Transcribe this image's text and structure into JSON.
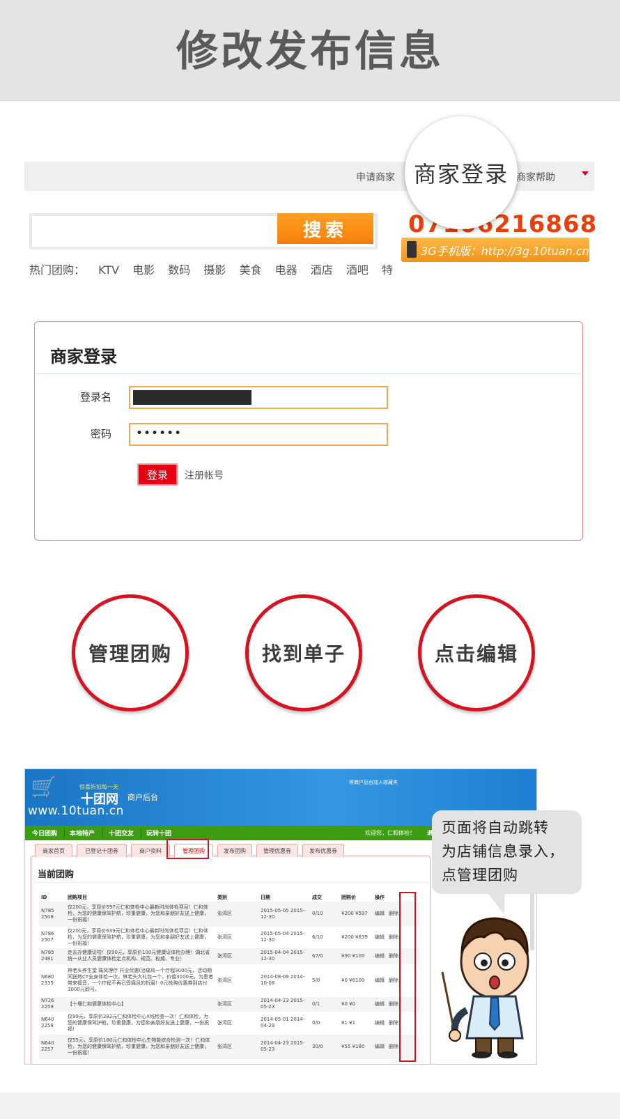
{
  "banner": {
    "title": "修改发布信息"
  },
  "topbar": {
    "apply_link": "申请商家",
    "merchant_login_zoom": "商家登录",
    "help_link": "商家帮助"
  },
  "search": {
    "button": "搜索",
    "hot_label": "热门团购：",
    "hot_items": [
      "KTV",
      "电影",
      "数码",
      "摄影",
      "美食",
      "电器",
      "酒店",
      "酒吧",
      "特"
    ]
  },
  "contact": {
    "phone": "07106216868",
    "mobile_banner": "3G手机版：http://3g.10tuan.cn"
  },
  "login": {
    "title": "商家登录",
    "username_label": "登录名",
    "password_label": "密码",
    "password_value": "••••••",
    "submit": "登录",
    "register": "注册帐号"
  },
  "steps": [
    "管理团购",
    "找到单子",
    "点击编辑"
  ],
  "admin": {
    "slogan": "惊喜折扣每一天",
    "brand": "十团网",
    "backend": "商户后台",
    "url": "www.10tuan.cn",
    "favorite": "将商户后台加入收藏夹",
    "nav": [
      "今日团购",
      "本地特产",
      "十团交友",
      "玩转十团"
    ],
    "welcome": "欢迎您，仁和体检！",
    "logout": "退出",
    "tabs": [
      "商家首页",
      "已登记十团券",
      "商户资料",
      "管理团购",
      "发布团购",
      "管理优惠券",
      "发布优惠券"
    ],
    "section_title": "当前团购",
    "columns": [
      "ID",
      "团购项目",
      "类别",
      "日期",
      "成交",
      "团购价",
      "操作"
    ],
    "rows": [
      {
        "id": "N785 2508",
        "item": "仅200元，享原价597元仁和体检中心最新时尚体检项目！仁和体检，为您的健康保驾护航，珍重健康，为您和亲朋好友送上健康，一份祝福！",
        "cat": "张湾区",
        "date": "2015-05-05 2015-12-30",
        "deal": "0/10",
        "price": "¥200 ¥597",
        "edit": "编辑",
        "del": "删除"
      },
      {
        "id": "N786 2507",
        "item": "仅200元，享原价639元仁和体检中心最新时尚体检项目！仁和体检，为您的健康保驾护航，珍重健康，为您和亲朋好友送上健康，一份祝福！",
        "cat": "张湾区",
        "date": "2015-05-04 2015-12-30",
        "deal": "6/10",
        "price": "¥200 ¥639",
        "edit": "编辑",
        "del": "删除"
      },
      {
        "id": "N785 2481",
        "item": "走去办健康证啦！仅90元，享原价100元健康证体检办理！湖北省统一从业人员健康体检定点机构、规范、权威、专业！",
        "cat": "张湾区",
        "date": "2015-04-04 2015-12-30",
        "deal": "67/0",
        "price": "¥90 ¥100",
        "edit": "编辑",
        "del": "删除"
      },
      {
        "id": "N680 2335",
        "item": "林老头养生堂 痛风理疗 开业优惠(治痛风一个疗程3000元，活动期间送热CT全身体检一次，林老头大礼包一个，价值3100元，为患者带来福音，一个疗程不再已受痛风的折磨！0元抢购优惠券到店付3000元即可。",
        "cat": "张湾区",
        "date": "2014-08-08 2014-10-08",
        "deal": "5/0",
        "price": "¥0 ¥6100",
        "edit": "编辑",
        "del": "删除"
      },
      {
        "id": "N726 2259",
        "item": "【十堰仁和健康体检中心】",
        "cat": "张湾区",
        "date": "2014-04-23 2015-05-23",
        "deal": "0/1",
        "price": "¥0 ¥0",
        "edit": "编辑",
        "del": "删除"
      },
      {
        "id": "N640 2258",
        "item": "仅99元，享原价282元仁和体检中心X线检查一次！仁和体检，为您的健康保驾护航，珍重健康，为您和亲朋好友送上健康，一份祝福！",
        "cat": "张湾区",
        "date": "2014-05-01 2014-04-29",
        "deal": "0/0",
        "price": "¥1 ¥1",
        "edit": "编辑",
        "del": "删除"
      },
      {
        "id": "N640 2257",
        "item": "仅55元，享原价180元仁和体检中心生物能综合检测一次！仁和体检，为您的健康保驾护航，珍重健康，为您和亲朋好友送上健康，一份祝福！",
        "cat": "张湾区",
        "date": "2014-04-23 2015-05-23",
        "deal": "30/0",
        "price": "¥55 ¥180",
        "edit": "编辑",
        "del": "删除"
      }
    ]
  },
  "callout": {
    "lines": [
      "页面将自动跳转",
      "为店铺信息录入，",
      "点管理团购"
    ]
  }
}
